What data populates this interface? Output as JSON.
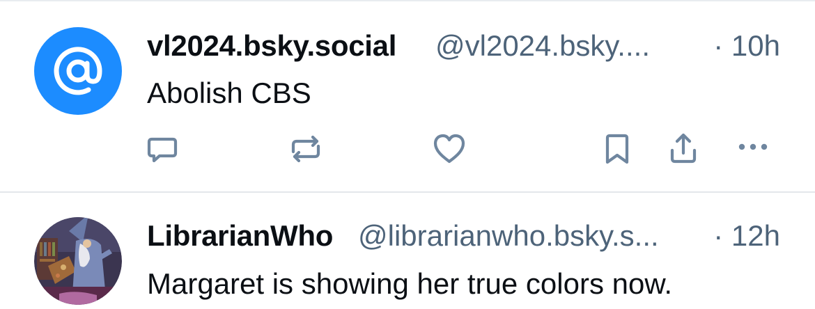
{
  "posts": [
    {
      "display_name": "vl2024.bsky.social",
      "handle": "@vl2024.bsky....",
      "time": "· 10h",
      "text": "Abolish CBS",
      "avatar_icon": "at-sign-icon",
      "actions": [
        "reply-icon",
        "repost-icon",
        "like-icon",
        "bookmark-icon",
        "share-icon",
        "more-icon"
      ]
    },
    {
      "display_name": "LibrarianWho",
      "handle": "@librarianwho.bsky.s...",
      "time": "· 12h",
      "text": "Margaret is showing her true colors now.",
      "avatar_icon": "wizard-illustration"
    }
  ],
  "colors": {
    "avatar_blue": "#1c8cff",
    "text_primary": "#0b0f14",
    "text_secondary": "#4d6379",
    "icon_gray": "#6f869f",
    "divider": "#e3e7eb"
  }
}
